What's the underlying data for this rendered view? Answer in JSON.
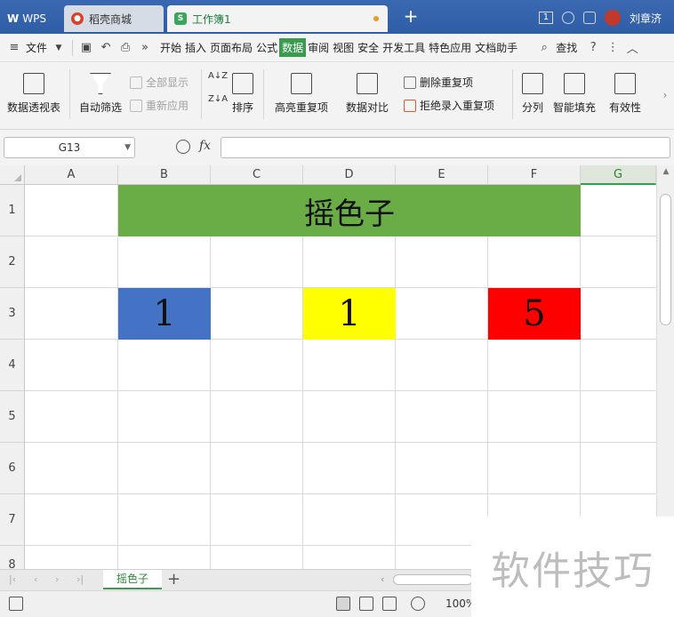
{
  "tabs": {
    "wps": "WPS",
    "daoke": "稻壳商城",
    "workbook": "工作簿1"
  },
  "title_right": {
    "window_count": "1",
    "user": "刘章济"
  },
  "menu": {
    "file": "文件",
    "items": [
      "开始",
      "插入",
      "页面布局",
      "公式",
      "数据",
      "审阅",
      "视图",
      "安全",
      "开发工具",
      "特色应用",
      "文档助手"
    ],
    "active": "数据",
    "search": "查找"
  },
  "ribbon": {
    "pivot": "数据透视表",
    "autofilter": "自动筛选",
    "show_all": "全部显示",
    "reapply": "重新应用",
    "sort": "排序",
    "highlight_dup": "高亮重复项",
    "compare": "数据对比",
    "delete_dup": "删除重复项",
    "reject_dup": "拒绝录入重复项",
    "split": "分列",
    "smart_fill": "智能填充",
    "validity": "有效性"
  },
  "formula": {
    "cell_ref": "G13",
    "fx": "fx",
    "value": ""
  },
  "grid": {
    "columns": [
      "A",
      "B",
      "C",
      "D",
      "E",
      "F",
      "G"
    ],
    "selected_column": "G",
    "rows": [
      "1",
      "2",
      "3",
      "4",
      "5",
      "6",
      "7",
      "8"
    ],
    "cells": {
      "title": "摇色子",
      "b3": "1",
      "d3": "1",
      "f3": "5"
    },
    "colors": {
      "title_bg": "#6aac46",
      "b3_bg": "#4472c4",
      "d3_bg": "#ffff00",
      "f3_bg": "#ff0000"
    }
  },
  "sheets": {
    "active": "摇色子"
  },
  "status": {
    "zoom": "100%"
  },
  "watermark": "软件技巧"
}
